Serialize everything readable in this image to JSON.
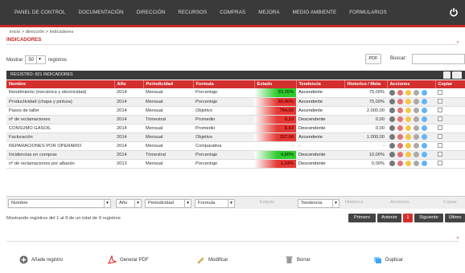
{
  "nav": {
    "items": [
      "PANEL DE CONTROL",
      "DOCUMENTACIÓN",
      "DIRECCIÓN",
      "RECURSOS",
      "COMPRAS",
      "MEJORA",
      "MEDIO AMBIENTE",
      "FORMULARIOS"
    ]
  },
  "breadcrumb": "inicio > dirección > indicadores",
  "page_title": "INDICADORES",
  "controls": {
    "show_label": "Mostrar",
    "show_value": "50",
    "records_label": "registros",
    "pdf_label": "PDF",
    "search_label": "Buscar:"
  },
  "regbar": {
    "title": "REGISTRO: 821   INDICADORES"
  },
  "table": {
    "headers": [
      "Nombre",
      "Año",
      "Periodicidad",
      "Formula",
      "Estado",
      "Tendencia",
      "Historico / Meta",
      "Acciones",
      "Copiar"
    ],
    "rows": [
      {
        "nombre": "Rendimiento (mecánica y electricidad)",
        "anio": "2014",
        "periodicidad": "Mensual",
        "formula": "Porcentaje",
        "estado": "93,35%",
        "estado_color": "#2ecc2e",
        "tendencia": "Ascendente",
        "historico": "75,00%"
      },
      {
        "nombre": "Productividad (chapa y pintura)",
        "anio": "2014",
        "periodicidad": "Mensual",
        "formula": "Porcentaje",
        "estado": "65,00%",
        "estado_color": "#e53935",
        "tendencia": "Ascendente",
        "historico": "75,00%"
      },
      {
        "nombre": "Pasos de taller",
        "anio": "2014",
        "periodicidad": "Mensual",
        "formula": "Objetivo",
        "estado": "794,00",
        "estado_color": "#e53935",
        "tendencia": "Ascendente",
        "historico": "2.000,00"
      },
      {
        "nombre": "nº de reclamaciones",
        "anio": "2014",
        "periodicidad": "Trimestral",
        "formula": "Promedio",
        "estado": "0,10",
        "estado_color": "#e53935",
        "tendencia": "Descendente",
        "historico": "0,00"
      },
      {
        "nombre": "CONSUMO GASOIL",
        "anio": "2014",
        "periodicidad": "Mensual",
        "formula": "Promedio",
        "estado": "8,63",
        "estado_color": "#e53935",
        "tendencia": "Descendente",
        "historico": "0,00"
      },
      {
        "nombre": "Facturación",
        "anio": "2014",
        "periodicidad": "Mensual",
        "formula": "Objetivo",
        "estado": "157,00",
        "estado_color": "#e53935",
        "tendencia": "Ascendente",
        "historico": "1.000,00"
      },
      {
        "nombre": "REPARACIONES POR OPERARIO",
        "anio": "2014",
        "periodicidad": "Mensual",
        "formula": "Comparativa",
        "estado": "-",
        "estado_color": "",
        "tendencia": "-",
        "historico": "-"
      },
      {
        "nombre": "Incidencias en compras",
        "anio": "2014",
        "periodicidad": "Trimestral",
        "formula": "Porcentaje",
        "estado": "4,80%",
        "estado_color": "#2ecc2e",
        "tendencia": "Descendente",
        "historico": "10,00%"
      },
      {
        "nombre": "nº de reclamaciones por albarán",
        "anio": "2013",
        "periodicidad": "Mensual",
        "formula": "Porcentaje",
        "estado": "1,24%",
        "estado_color": "#e53935",
        "tendencia": "Descendente",
        "historico": "0,00%"
      }
    ]
  },
  "filters": {
    "nombre": "Nombre",
    "anio": "Año",
    "periodicidad": "Periodicidad",
    "formula": "Formula",
    "estado": "Estado",
    "tendencia": "Tendencia",
    "historico": "Historico",
    "acciones": "Acciones",
    "copiar": "Copiar"
  },
  "info": "Mostrando registros del 1 al 9 de un total de 9 registros",
  "pager": {
    "first": "Primero",
    "prev": "Anterior",
    "current": "1",
    "next": "Siguiente",
    "last": "Último"
  },
  "actions": {
    "add": "Añade registro",
    "pdf": "Generar PDF",
    "edit": "Modificar",
    "delete": "Borrar",
    "duplicate": "Duplicar"
  }
}
